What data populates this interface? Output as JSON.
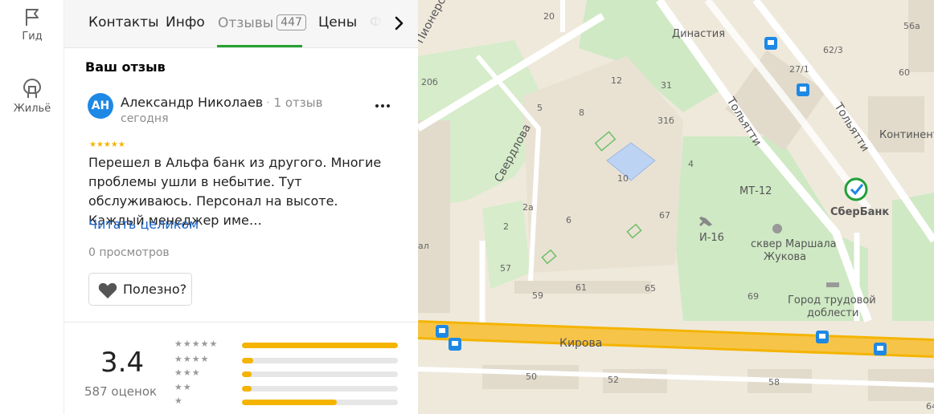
{
  "rail": {
    "items": [
      {
        "label": "Гид",
        "icon": "flag-icon"
      },
      {
        "label": "Жильё",
        "icon": "house-icon"
      }
    ]
  },
  "tabs": {
    "items": [
      {
        "label": "Контакты",
        "active": false
      },
      {
        "label": "Инфо",
        "active": false
      },
      {
        "label": "Отзывы",
        "count": "447",
        "active": true
      },
      {
        "label": "Цены",
        "active": false
      }
    ],
    "faded": "Ф"
  },
  "review_section": {
    "title": "Ваш отзыв",
    "author": {
      "initials": "АН",
      "name": "Александр Николаев",
      "reviews": "1 отзыв",
      "date": "сегодня",
      "avatar_color": "#1e88e5"
    },
    "rating_stars": 5,
    "stars_glyph": "★★★★★",
    "text": "Перешел в Альфа банк из другого. Многие проблемы ушли в небытие. Тут обслуживаюсь. Персонал на высоте. Каждый менеджер име…",
    "read_more": "Читать целиком",
    "views": "0 просмотров",
    "useful_label": "Полезно?"
  },
  "rating_summary": {
    "score": "3.4",
    "count_label": "587 оценок",
    "distribution": [
      {
        "stars": "★★★★★",
        "fraction": 1.0
      },
      {
        "stars": "★★★★",
        "fraction": 0.07
      },
      {
        "stars": "★★★",
        "fraction": 0.06
      },
      {
        "stars": "★★",
        "fraction": 0.06
      },
      {
        "stars": "★",
        "fraction": 0.61
      }
    ],
    "accent": "#f4b400"
  },
  "map": {
    "streets": [
      "Пионерский",
      "Свердлова",
      "Тольятти",
      "Тольятти",
      "Кирова"
    ],
    "places": [
      {
        "label": "Династия"
      },
      {
        "label": "СберБанк"
      },
      {
        "label": "МТ-12"
      },
      {
        "label": "И-16"
      },
      {
        "label": "сквер Маршала"
      },
      {
        "label": "Жукова"
      },
      {
        "label": "Город трудовой"
      },
      {
        "label": "доблести"
      },
      {
        "label": "Континент"
      }
    ],
    "house_numbers": [
      "20",
      "62/3",
      "56a",
      "20б",
      "27/1",
      "60",
      "12",
      "31",
      "5",
      "8",
      "31б",
      "4",
      "10",
      "2a",
      "6",
      "2",
      "67",
      "57",
      "61",
      "59",
      "65",
      "69",
      "50",
      "52",
      "58",
      "64",
      "ал"
    ],
    "colors": {
      "road_major": "#f7b731",
      "park": "#cfe9c4",
      "building": "#e2dbcb",
      "water": "#bcd3f3",
      "ground": "#efe9dc"
    }
  }
}
